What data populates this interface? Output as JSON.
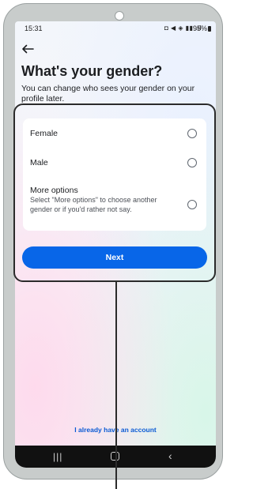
{
  "status_bar": {
    "time": "15:31",
    "icons": "◘ ◀ ◈ ▮▮ .ıl",
    "battery": "95%"
  },
  "screen": {
    "back_icon": "back-arrow-icon",
    "title": "What's your gender?",
    "subtitle": "You can change who sees your gender on your profile later."
  },
  "options": [
    {
      "label": "Female",
      "description": ""
    },
    {
      "label": "Male",
      "description": ""
    },
    {
      "label": "More options",
      "description": "Select \"More options\" to choose another gender or if you'd rather not say."
    }
  ],
  "next_button": {
    "label": "Next"
  },
  "login_link": {
    "label": "I already have an account"
  },
  "nav": {
    "recents_icon": "recents-icon",
    "home_icon": "home-icon",
    "back_icon": "nav-back-icon"
  },
  "colors": {
    "accent": "#0866e8",
    "link": "#0a5ad4",
    "text": "#1c1e21"
  }
}
